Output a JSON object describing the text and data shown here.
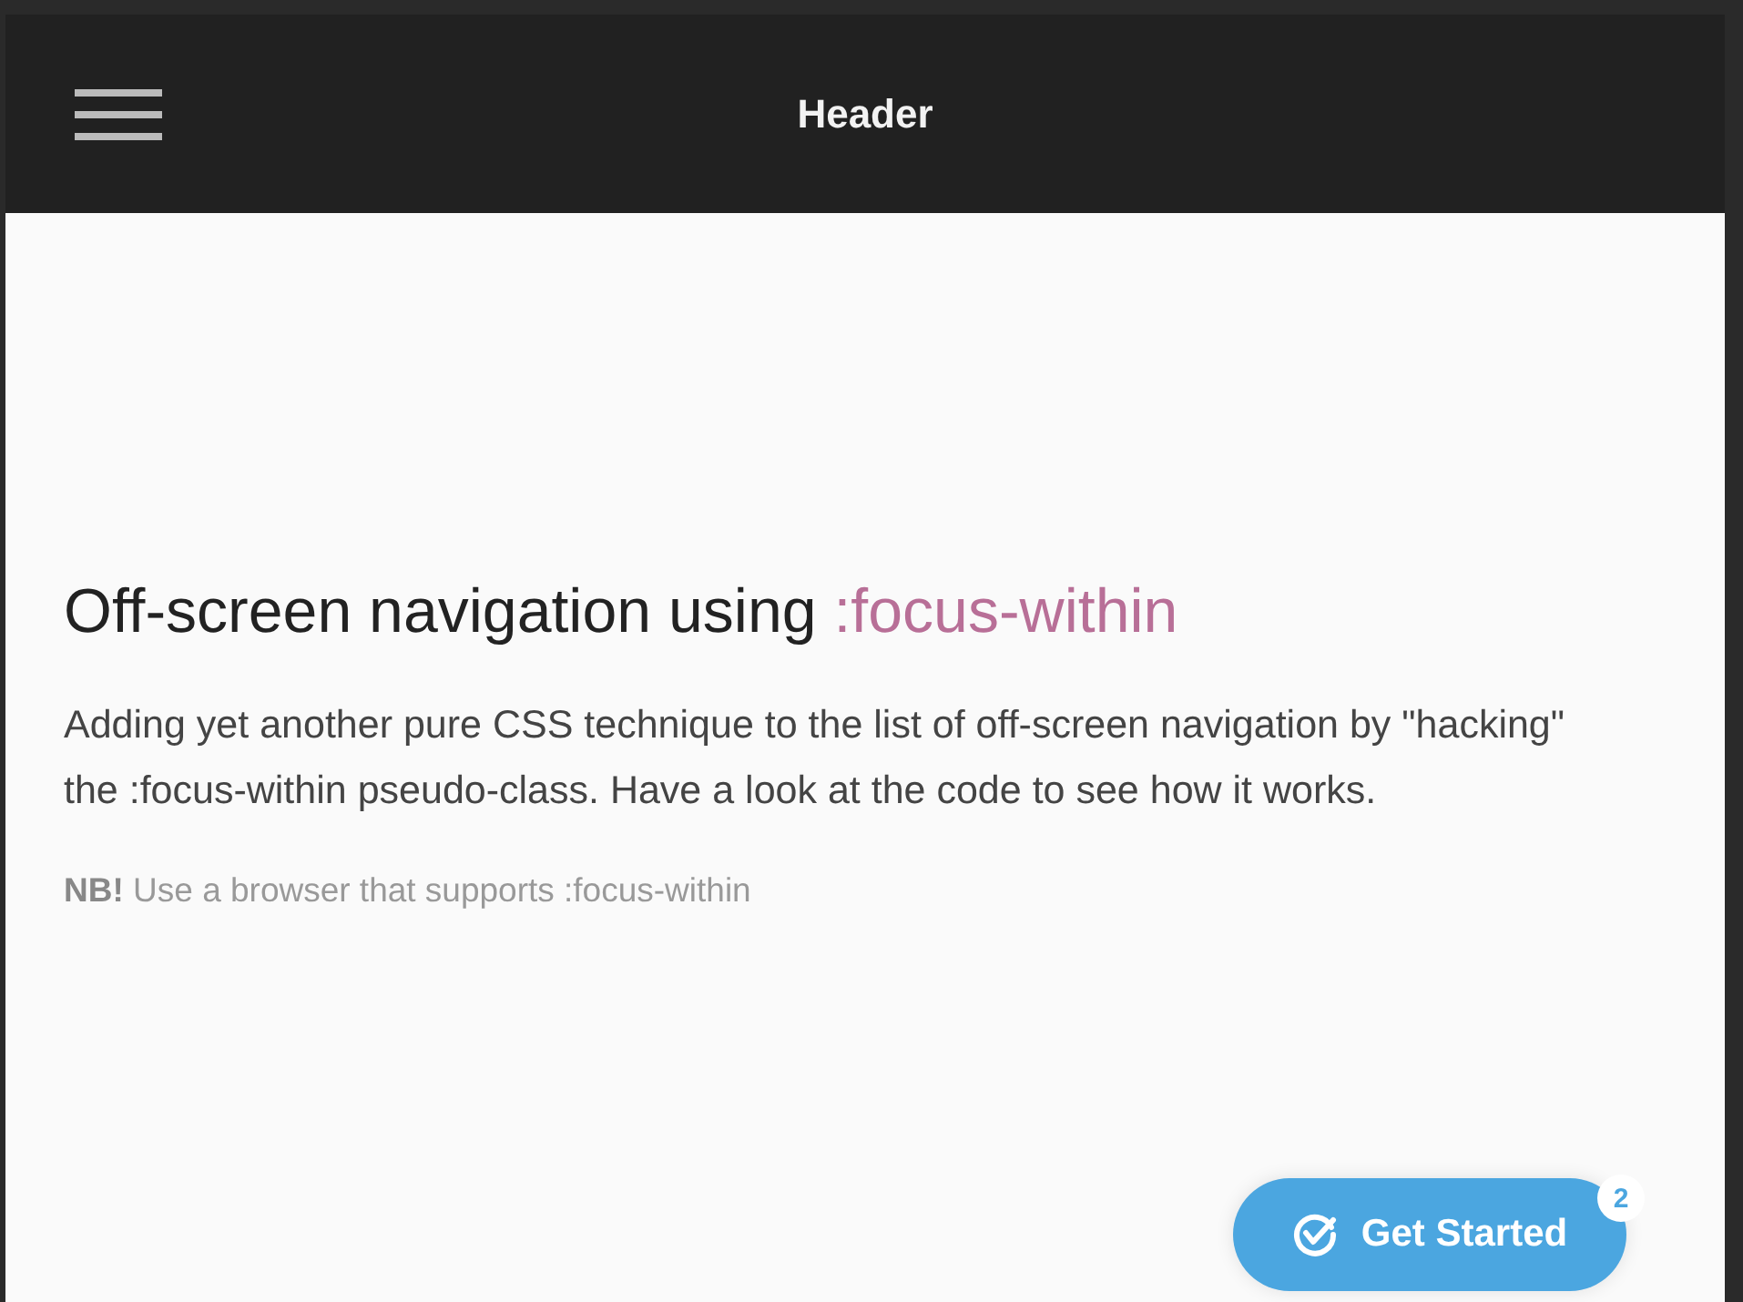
{
  "header": {
    "title": "Header"
  },
  "intro": {
    "title": "Off-screen navigation using",
    "title_highlight": ":focus-within",
    "body": "Adding yet another pure CSS technique to the list of off-screen navigation by \"hacking\" the :focus-within pseudo-class. Have a look at the code to see how it works.",
    "note": "**NB!** Use a browser that supports :focus-within"
  },
  "cta": {
    "label": "Get Started",
    "badge": "2"
  }
}
